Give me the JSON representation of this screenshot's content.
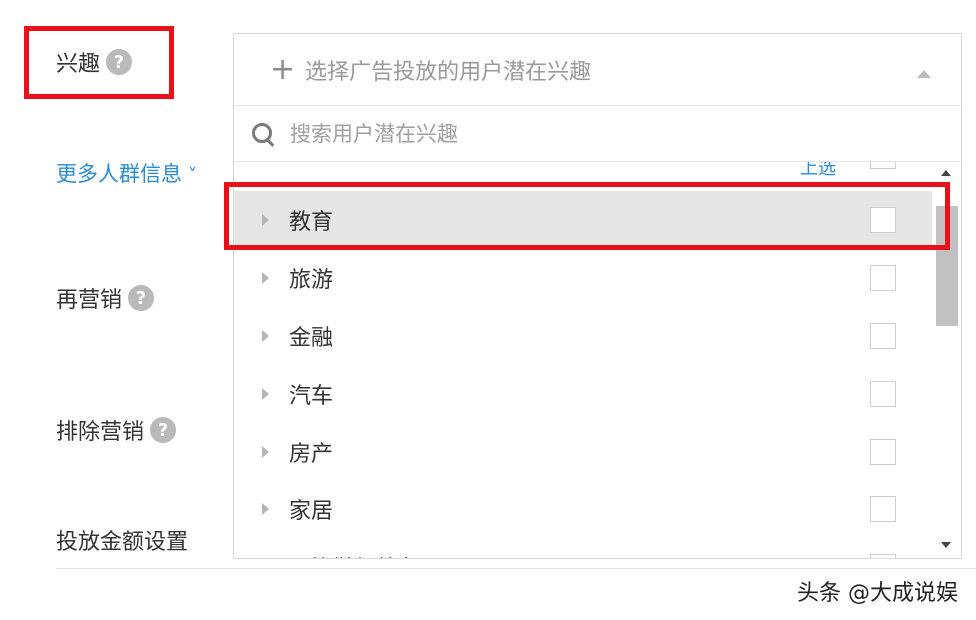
{
  "form": {
    "interest_label": "兴趣",
    "more_link": "更多人群信息",
    "remarketing_label": "再营销",
    "exclude_label": "排除营销",
    "amount_label": "投放金额设置",
    "help_glyph": "?"
  },
  "picker": {
    "placeholder": "选择广告投放的用户潜在兴趣",
    "search_placeholder": "搜索用户潜在兴趣",
    "partial_top_text": "上选",
    "items": [
      {
        "label": "教育",
        "selected": true
      },
      {
        "label": "旅游",
        "selected": false
      },
      {
        "label": "金融",
        "selected": false
      },
      {
        "label": "汽车",
        "selected": false
      },
      {
        "label": "房产",
        "selected": false
      },
      {
        "label": "家居",
        "selected": false
      },
      {
        "label": "服饰鞋帽箱包",
        "selected": false
      }
    ]
  },
  "icons": {
    "plus": "plus-icon",
    "search": "search-icon",
    "help": "question-circle-icon",
    "expand": "triangle-right-icon",
    "chevron": "chevron-down-icon"
  },
  "colors": {
    "highlight_red": "#e8101a",
    "link_blue": "#2a8bd5",
    "selected_row": "#e6e6e6"
  },
  "watermark": "头条 @大成说娱"
}
